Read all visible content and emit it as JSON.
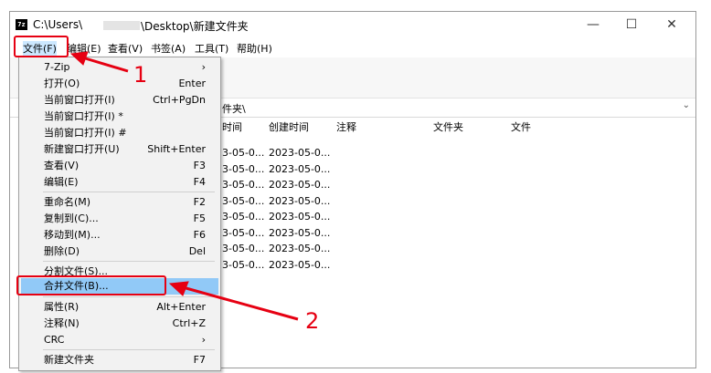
{
  "window": {
    "title_prefix": "C:\\Users\\",
    "title_suffix": "\\Desktop\\新建文件夹",
    "app_icon_text": "7z",
    "icons": [
      "app-7zip-icon",
      "minimize-icon",
      "maximize-icon",
      "close-icon"
    ],
    "controls": {
      "minimize": "—",
      "maximize": "☐",
      "close": "✕"
    }
  },
  "menubar": {
    "items": [
      "文件(F)",
      "编辑(E)",
      "查看(V)",
      "书签(A)",
      "工具(T)",
      "帮助(H)"
    ]
  },
  "address": {
    "text": "件夹\\",
    "dropdown_glyph": "⌄"
  },
  "filelist": {
    "columns": [
      "时间",
      "创建时间",
      "注释",
      "文件夹",
      "文件"
    ],
    "rows": [
      [
        "3-05-0...",
        "2023-05-0..."
      ],
      [
        "3-05-0...",
        "2023-05-0..."
      ],
      [
        "3-05-0...",
        "2023-05-0..."
      ],
      [
        "3-05-0...",
        "2023-05-0..."
      ],
      [
        "3-05-0...",
        "2023-05-0..."
      ],
      [
        "3-05-0...",
        "2023-05-0..."
      ],
      [
        "3-05-0...",
        "2023-05-0..."
      ],
      [
        "3-05-0...",
        "2023-05-0..."
      ]
    ]
  },
  "file_menu": {
    "items": [
      {
        "label": "7-Zip",
        "shortcut": "›"
      },
      {
        "label": "打开(O)",
        "shortcut": "Enter"
      },
      {
        "label": "当前窗口打开(I)",
        "shortcut": "Ctrl+PgDn"
      },
      {
        "label": "当前窗口打开(I) *",
        "shortcut": ""
      },
      {
        "label": "当前窗口打开(I) #",
        "shortcut": ""
      },
      {
        "label": "新建窗口打开(U)",
        "shortcut": "Shift+Enter"
      },
      {
        "label": "查看(V)",
        "shortcut": "F3"
      },
      {
        "label": "编辑(E)",
        "shortcut": "F4"
      },
      {
        "label": "重命名(M)",
        "shortcut": "F2"
      },
      {
        "label": "复制到(C)...",
        "shortcut": "F5"
      },
      {
        "label": "移动到(M)...",
        "shortcut": "F6"
      },
      {
        "label": "删除(D)",
        "shortcut": "Del"
      },
      {
        "label": "分割文件(S)...",
        "shortcut": ""
      },
      {
        "label": "合并文件(B)...",
        "shortcut": ""
      },
      {
        "label": "属性(R)",
        "shortcut": "Alt+Enter"
      },
      {
        "label": "注释(N)",
        "shortcut": "Ctrl+Z"
      },
      {
        "label": "CRC",
        "shortcut": "›"
      },
      {
        "label": "新建文件夹",
        "shortcut": "F7"
      }
    ],
    "highlighted_index": 13
  },
  "annotations": {
    "callout_1": "1",
    "callout_2": "2",
    "color": "#e60012"
  },
  "colors": {
    "menu_highlight": "#91c9f7",
    "menubar_active": "#cce8ff",
    "menu_background": "#f2f2f2"
  }
}
